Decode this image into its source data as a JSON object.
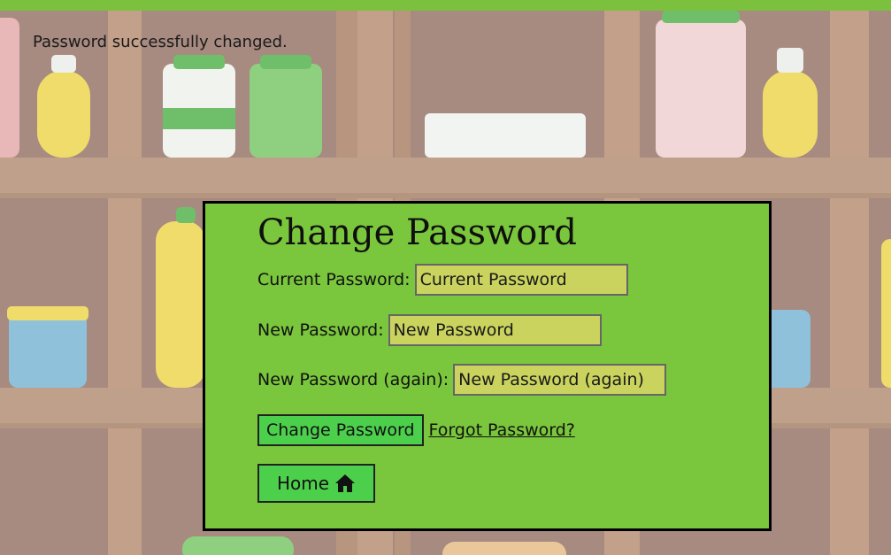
{
  "status_message": "Password successfully changed.",
  "dialog": {
    "title": "Change Password",
    "fields": {
      "current": {
        "label": "Current Password:",
        "placeholder": "Current Password"
      },
      "new": {
        "label": "New Password:",
        "placeholder": "New Password"
      },
      "again": {
        "label": "New Password (again):",
        "placeholder": "New Password (again)"
      }
    },
    "submit_label": "Change Password",
    "forgot_link": "Forgot Password?",
    "home_label": "Home",
    "home_icon": "home-icon"
  },
  "colors": {
    "accent_bar": "#7bc13d",
    "dialog_bg": "#7ac63c",
    "input_bg": "#c9d35e",
    "button_bg": "#4cd04c"
  }
}
